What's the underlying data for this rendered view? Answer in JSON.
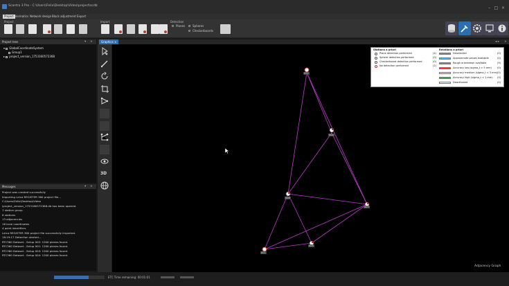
{
  "window": {
    "title": "Scantra 3 Pro - C:\\Users\\Felix\\Desktop\\Video\\project\\scdb"
  },
  "menu": {
    "items": [
      "Project",
      "Kinematics",
      "Network design",
      "Block adjustment",
      "Export"
    ]
  },
  "ribbon": {
    "groups": {
      "project": "Project",
      "import": "Import",
      "detection": "Detection"
    },
    "detection": {
      "option_planes": "Planes",
      "option_spheres": "Spheres",
      "option_checkerboards": "Checkerboards"
    }
  },
  "project_tree": {
    "header": "Project tree",
    "items": [
      "GlobalCoordinateSystem",
      "Group1",
      "project_version_1753160572368"
    ]
  },
  "messages": {
    "header": "Messages",
    "lines": [
      "Project was created successfully",
      "Importing Leica REGISTER 360 project file...",
      "C:\\Users\\Felix\\Desktop\\Video",
      "\\project_version_1753160572368.db has been opened.",
      "1 station group",
      "8 stations",
      "13 adjacencies",
      "16 local coordinates",
      "4 point identifiers",
      "Leica REGISTER 360 project file successfully imported.",
      "18:19:17  Detection started...",
      "RTC360 Dataset - Setup 002: 1200 planes found.",
      "RTC360 Dataset - Setup 001: 1200 planes found.",
      "RTC360 Dataset - Setup 003: 1200 planes found.",
      "RTC360 Dataset - Setup 004: 1200 planes found."
    ]
  },
  "graphics": {
    "tab": "Graphics",
    "view_label": "Adjacency Graph",
    "legend": {
      "stations_title": "Stations a priori",
      "relations_title": "Relations a priori",
      "stations": [
        {
          "label": "Plane detection performed",
          "count": "(4)"
        },
        {
          "label": "Sphere detection performed",
          "count": "(0)"
        },
        {
          "label": "Checkerboard detection performed",
          "count": "(0)"
        },
        {
          "label": "No detection performed",
          "count": "(2)"
        }
      ],
      "relations": [
        {
          "label": "Deselected",
          "count": "(0)",
          "color": "#8a8a8a"
        },
        {
          "label": "Approximate values available",
          "count": "(0)",
          "color": "#4fc3f7"
        },
        {
          "label": "Rough orientation available",
          "count": "(9)",
          "color": "#e040fb"
        },
        {
          "label": "Accuracy low (sigma_t > 5 mm)",
          "count": "(0)",
          "color": "#e53935"
        },
        {
          "label": "Accuracy medium (sigma_t < 3 mm)",
          "count": "(0)",
          "color": "#ffeb3b"
        },
        {
          "label": "Accuracy high (sigma_t < 1 mm)",
          "count": "(0)",
          "color": "#43a047"
        },
        {
          "label": "Deactivated",
          "count": "(0)",
          "color": "#ffffff"
        }
      ]
    },
    "nodes": [
      "002",
      "004",
      "006",
      "003",
      "001",
      "005"
    ]
  },
  "status": {
    "text": "ETC  Time remaining: 00:01:01",
    "progress": 0.68
  },
  "colors": {
    "accent": "#2f6fb5",
    "edge": "#c03bd0"
  }
}
